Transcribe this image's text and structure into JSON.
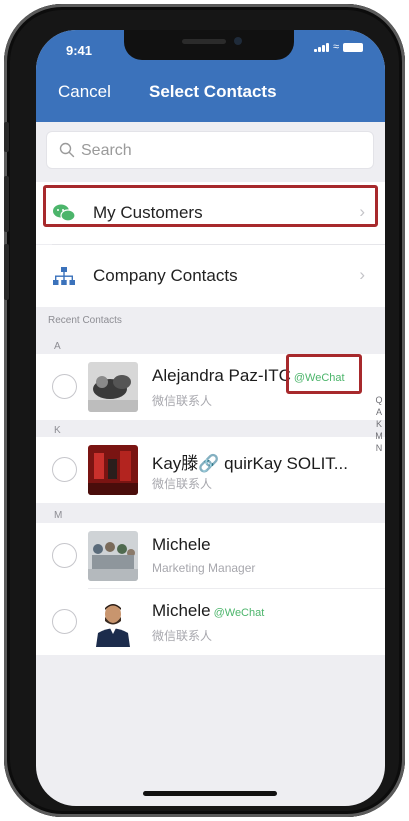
{
  "status_bar": {
    "time": "9:41"
  },
  "nav": {
    "cancel_label": "Cancel",
    "title": "Select Contacts"
  },
  "search": {
    "placeholder": "Search"
  },
  "menu": [
    {
      "label": "My Customers",
      "icon": "wechat-customers-icon"
    },
    {
      "label": "Company Contacts",
      "icon": "org-chart-icon"
    }
  ],
  "recent_header": "Recent Contacts",
  "groups": [
    {
      "letter": "A",
      "contacts": [
        {
          "name": "Alejandra Paz-ITC",
          "tag": "@WeChat",
          "subtitle": "微信联系人"
        }
      ]
    },
    {
      "letter": "K",
      "contacts": [
        {
          "name": "Kay滕🔗 quirKay SOLIT...",
          "tag": "",
          "subtitle": "微信联系人"
        }
      ]
    },
    {
      "letter": "M",
      "contacts": [
        {
          "name": "Michele",
          "tag": "",
          "subtitle": "Marketing Manager"
        },
        {
          "name": "Michele",
          "tag": "@WeChat",
          "subtitle": "微信联系人"
        }
      ]
    }
  ],
  "index_letters": [
    "Q",
    "A",
    "K",
    "M",
    "N"
  ],
  "colors": {
    "nav_blue": "#3b72bb",
    "wechat_green": "#4cb56b",
    "highlight_red": "#a7292c"
  }
}
